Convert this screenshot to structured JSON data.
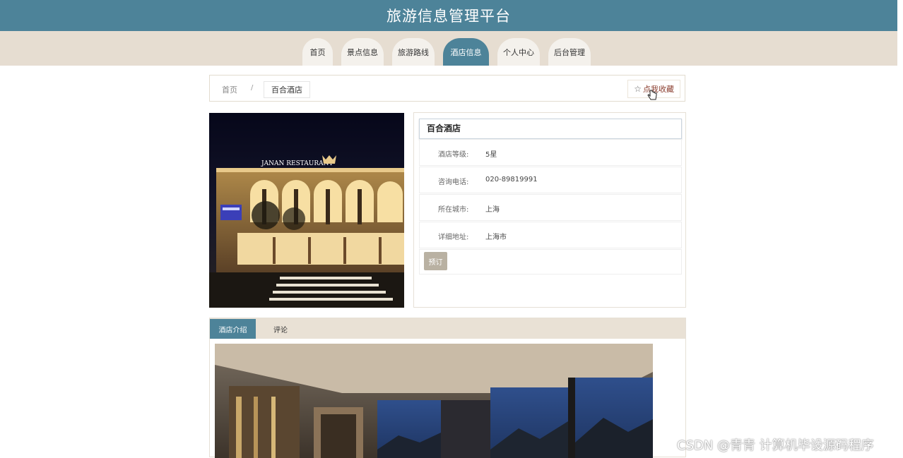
{
  "header": {
    "title": "旅游信息管理平台"
  },
  "nav": {
    "items": [
      {
        "label": "首页"
      },
      {
        "label": "景点信息"
      },
      {
        "label": "旅游路线"
      },
      {
        "label": "酒店信息"
      },
      {
        "label": "个人中心"
      },
      {
        "label": "后台管理"
      }
    ],
    "active_index": 3
  },
  "breadcrumb": {
    "home": "首页",
    "separator": "/",
    "current": "百合酒店"
  },
  "favorite_button": {
    "label": "点我收藏",
    "icon": "star-outline-icon"
  },
  "hotel": {
    "photo_sign": "JANAN RESTAURANT",
    "name": "百合酒店",
    "fields": [
      {
        "label": "酒店等级:",
        "value": "5星"
      },
      {
        "label": "咨询电话:",
        "value": "020-89819991"
      },
      {
        "label": "所在城市:",
        "value": "上海"
      },
      {
        "label": "详细地址:",
        "value": "上海市"
      }
    ],
    "book_label": "预订"
  },
  "tabs": [
    {
      "label": "酒店介绍",
      "active": true
    },
    {
      "label": "评论",
      "active": false
    }
  ],
  "watermark": "CSDN @青青  计算机毕设源码程序",
  "colors": {
    "primary": "#4d8399",
    "nav_bg": "#e6ddd1",
    "book_button": "#b9b1a2"
  }
}
